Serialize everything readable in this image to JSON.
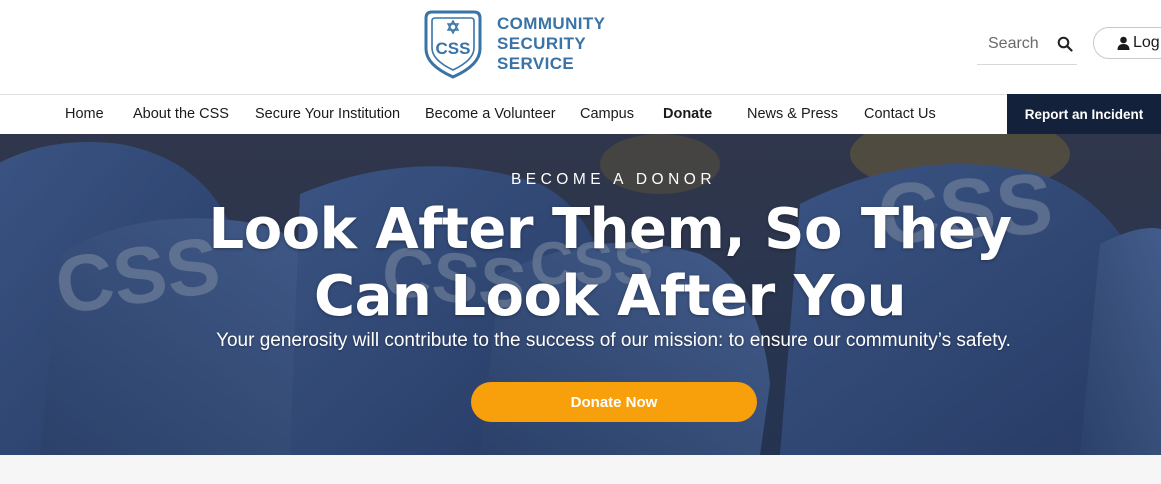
{
  "brand": {
    "logo_initials": "CSS",
    "name_lines": [
      "COMMUNITY",
      "SECURITY",
      "SERVICE"
    ],
    "color": "#3a73a6"
  },
  "search": {
    "placeholder": "Search",
    "icon": "search-icon"
  },
  "account": {
    "login_label": "Log",
    "icon": "user-icon"
  },
  "nav": {
    "items": [
      {
        "label": "Home"
      },
      {
        "label": "About the CSS"
      },
      {
        "label": "Secure Your Institution"
      },
      {
        "label": "Become a Volunteer"
      },
      {
        "label": "Campus"
      },
      {
        "label": "Donate"
      },
      {
        "label": "News & Press"
      },
      {
        "label": "Contact Us"
      }
    ],
    "cta_label": "Report an Incident",
    "cta_color": "#14213a"
  },
  "hero": {
    "eyebrow": "BECOME A DONOR",
    "headline": "Look After Them, So They Can Look After You",
    "subline": "Your generosity will contribute to the success of our mission: to ensure our community’s safety.",
    "button_label": "Donate Now",
    "button_color": "#f7a00c",
    "jacket_text": "CSS"
  }
}
